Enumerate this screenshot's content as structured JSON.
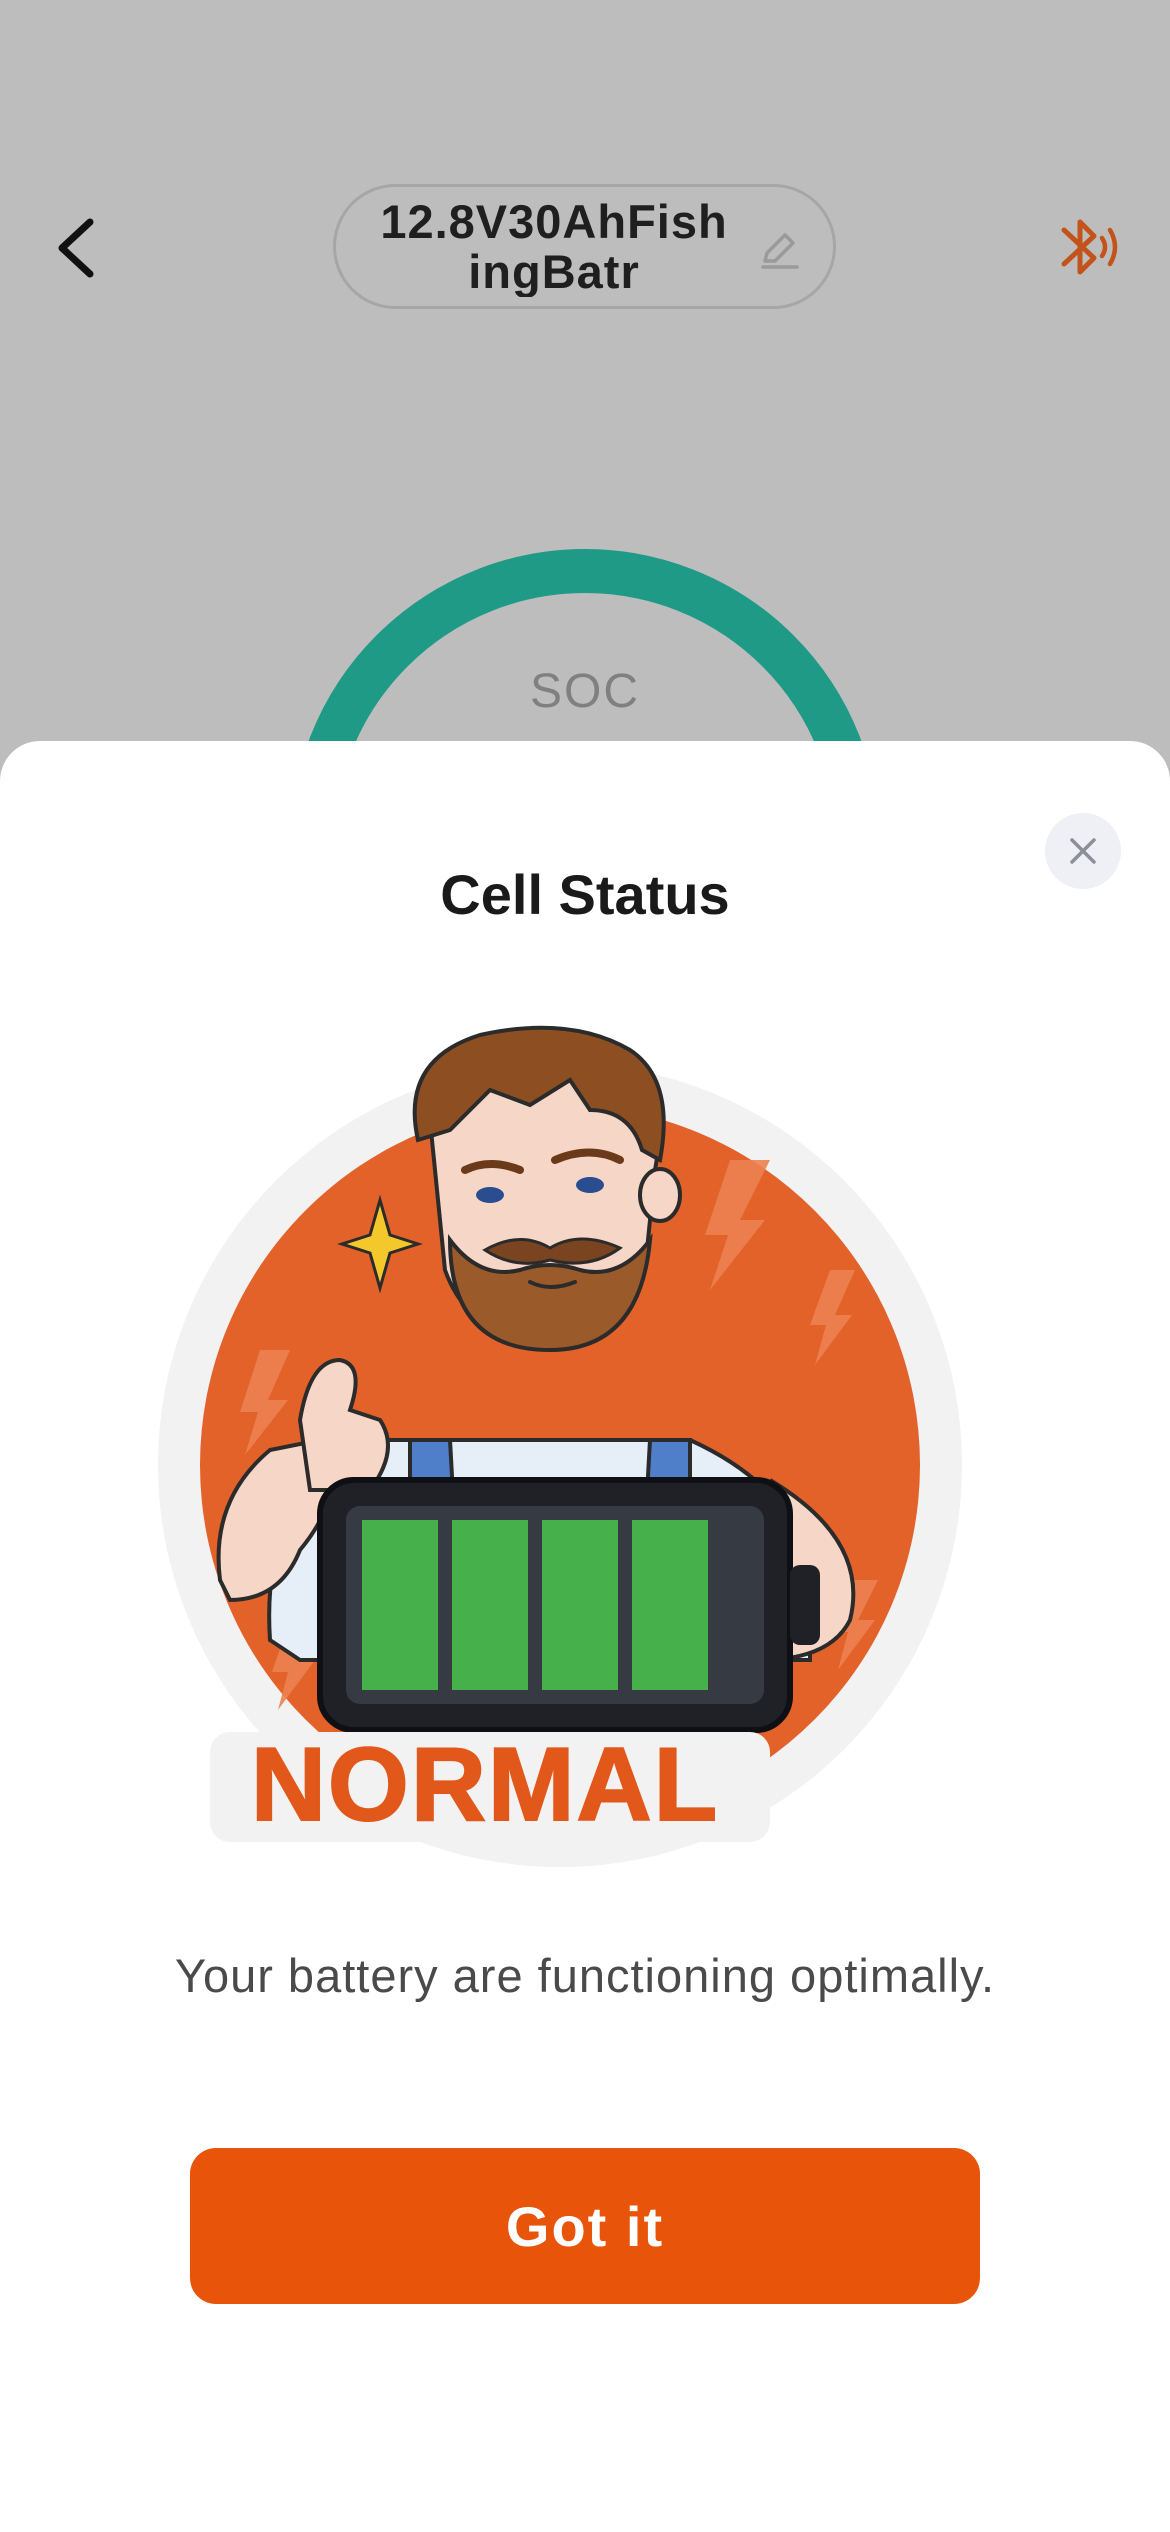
{
  "header": {
    "device_name": "12.8V30AhFishingBatr",
    "back_icon": "chevron-left-icon",
    "edit_icon": "pencil-icon",
    "bluetooth_icon": "bluetooth-connected-icon"
  },
  "gauge": {
    "label": "SOC"
  },
  "sheet": {
    "title": "Cell Status",
    "status_badge": "NORMAL",
    "message": "Your battery are functioning optimally.",
    "button_label": "Got it",
    "close_icon": "close-icon"
  },
  "battery_illustration": {
    "filled_bars": 4,
    "total_bars": 4
  },
  "colors": {
    "accent": "#E8540A",
    "gauge_teal": "#1E9A86",
    "battery_green": "#46B04A",
    "bluetooth": "#C2531B"
  }
}
